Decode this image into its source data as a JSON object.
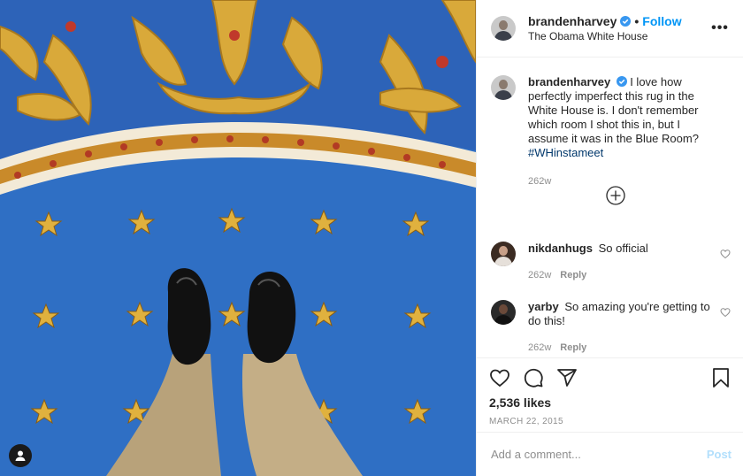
{
  "header": {
    "username": "brandenharvey",
    "separator": "•",
    "follow_label": "Follow",
    "location": "The Obama White House",
    "more_label": "•••"
  },
  "caption": {
    "username": "brandenharvey",
    "text": "I love how perfectly imperfect this rug in the White House is. I don't remember which room I shot this in, but I assume it was in the Blue Room?",
    "hashtag": "#WHinstameet",
    "age": "262w"
  },
  "comments": [
    {
      "username": "nikdanhugs",
      "text": "So official",
      "age": "262w",
      "reply_label": "Reply"
    },
    {
      "username": "yarby",
      "text": "So amazing you're getting to do this!",
      "age": "262w",
      "reply_label": "Reply"
    }
  ],
  "actions": {
    "likes": "2,536 likes",
    "date": "MARCH 22, 2015"
  },
  "add_comment": {
    "placeholder": "Add a comment...",
    "post_label": "Post"
  },
  "icons": [
    "verified-icon",
    "more-icon",
    "load-more-icon",
    "heart-icon",
    "comment-icon",
    "share-icon",
    "bookmark-icon",
    "tag-user-icon"
  ],
  "colors": {
    "link": "#0095f6",
    "hashtag": "#00376b",
    "muted": "#8e8e8e",
    "rug_blue": "#2f6fc4",
    "rug_gold": "#d9a93a"
  }
}
